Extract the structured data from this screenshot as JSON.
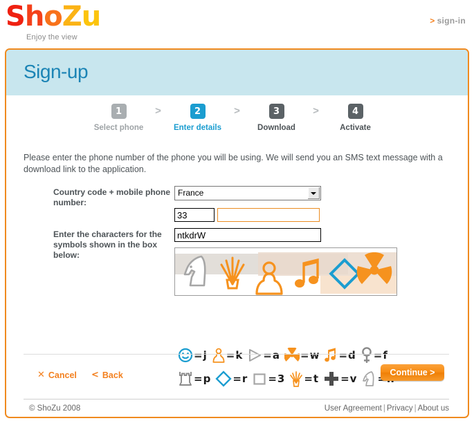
{
  "brand": {
    "name_parts": [
      "S",
      "h",
      "o",
      "Z",
      "u"
    ],
    "tagline": "Enjoy the view",
    "colors": {
      "red": "#ef2111",
      "orange": "#f8721b",
      "yellow": "#fcc40d",
      "accent_orange": "#f08a1e",
      "accent_blue": "#1b9dd0",
      "header_band": "#c8e6ee"
    }
  },
  "topbar": {
    "signin_label": "sign-in",
    "signin_chevron": ">"
  },
  "panel": {
    "title": "Sign-up"
  },
  "steps": {
    "separator": ">",
    "items": [
      {
        "number": "1",
        "label": "Select phone",
        "state": "done"
      },
      {
        "number": "2",
        "label": "Enter details",
        "state": "active"
      },
      {
        "number": "3",
        "label": "Download",
        "state": "upcoming"
      },
      {
        "number": "4",
        "label": "Activate",
        "state": "upcoming"
      }
    ]
  },
  "intro": {
    "text": "Please enter the phone number of the phone you will be using. We will send you an SMS text message with a download link to the application."
  },
  "form": {
    "phone": {
      "label": "Country code + mobile phone number:",
      "country_selected": "France",
      "country_options": [
        "France"
      ],
      "country_code_value": "33",
      "phone_number_value": "",
      "phone_number_placeholder": ""
    },
    "captcha": {
      "label": "Enter the characters for the symbols shown in the box below:",
      "value": "ntkdrW",
      "placeholder": ""
    }
  },
  "captcha_image": {
    "symbols": [
      {
        "name": "chess-knight",
        "color": "#a6a6a6"
      },
      {
        "name": "fire",
        "color": "#f6921e"
      },
      {
        "name": "person",
        "color": "#f6921e"
      },
      {
        "name": "music-note",
        "color": "#f6921e"
      },
      {
        "name": "diamond",
        "color": "#1b9dd0"
      },
      {
        "name": "radiation",
        "color": "#f6921e"
      }
    ]
  },
  "legend": {
    "rows": [
      [
        {
          "icon": "smiley",
          "color": "#1b9dd0",
          "char": "j"
        },
        {
          "icon": "person",
          "color": "#f6921e",
          "char": "k"
        },
        {
          "icon": "triangle",
          "color": "#a6a6a6",
          "char": "a"
        },
        {
          "icon": "radiation",
          "color": "#f6921e",
          "char": "w"
        },
        {
          "icon": "music-note",
          "color": "#f6921e",
          "char": "d"
        },
        {
          "icon": "female",
          "color": "#8a8a8a",
          "char": "f"
        }
      ],
      [
        {
          "icon": "chess-rook",
          "color": "#8a8a8a",
          "char": "p"
        },
        {
          "icon": "diamond",
          "color": "#1b9dd0",
          "char": "r"
        },
        {
          "icon": "square",
          "color": "#a6a6a6",
          "char": "3"
        },
        {
          "icon": "fire",
          "color": "#f6921e",
          "char": "t"
        },
        {
          "icon": "cross",
          "color": "#4d4d4d",
          "char": "v"
        },
        {
          "icon": "chess-knight",
          "color": "#a6a6a6",
          "char": "n"
        }
      ]
    ],
    "equals": "="
  },
  "actions": {
    "cancel_label": "Cancel",
    "cancel_mark": "✕",
    "back_label": "Back",
    "back_mark": "<",
    "continue_label": "Continue >"
  },
  "footer": {
    "copyright": "© ShoZu 2008",
    "links": [
      "User Agreement",
      "Privacy",
      "About us"
    ],
    "separator": "|"
  }
}
